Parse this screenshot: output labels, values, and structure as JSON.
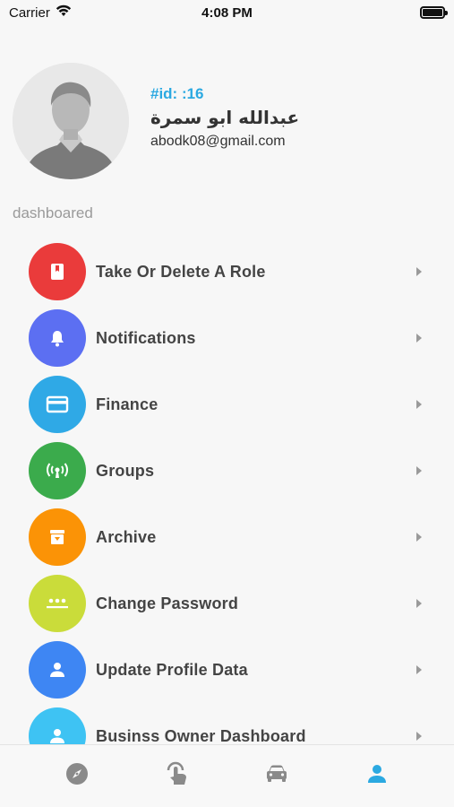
{
  "status_bar": {
    "carrier": "Carrier",
    "time": "4:08 PM"
  },
  "profile": {
    "id_label": "#id: :16",
    "name": "عبدالله ابو سمرة",
    "email": "abodk08@gmail.com"
  },
  "section_title": "dashboared",
  "menu": {
    "items": [
      {
        "label": "Take Or Delete A Role",
        "icon": "bookmark-book-icon",
        "color": "#ea3b3b"
      },
      {
        "label": "Notifications",
        "icon": "bell-icon",
        "color": "#5c6ff2"
      },
      {
        "label": "Finance",
        "icon": "credit-card-icon",
        "color": "#2fa9e6"
      },
      {
        "label": "Groups",
        "icon": "broadcast-icon",
        "color": "#3bab4c"
      },
      {
        "label": "Archive",
        "icon": "archive-box-icon",
        "color": "#fb9306"
      },
      {
        "label": "Change Password",
        "icon": "password-dots-icon",
        "color": "#cadc3a"
      },
      {
        "label": "Update Profile Data",
        "icon": "person-icon",
        "color": "#3e86f3"
      },
      {
        "label": "Businss Owner Dashboard",
        "icon": "person-icon",
        "color": "#3ec3f3"
      }
    ]
  },
  "tab_bar": {
    "tabs": [
      {
        "name": "explore",
        "icon": "compass-icon",
        "active": false
      },
      {
        "name": "touch",
        "icon": "touch-hand-icon",
        "active": false
      },
      {
        "name": "car",
        "icon": "car-icon",
        "active": false
      },
      {
        "name": "profile",
        "icon": "person-icon",
        "active": true
      }
    ],
    "active_color": "#2ba9e1",
    "inactive_color": "#8a8a8a"
  }
}
